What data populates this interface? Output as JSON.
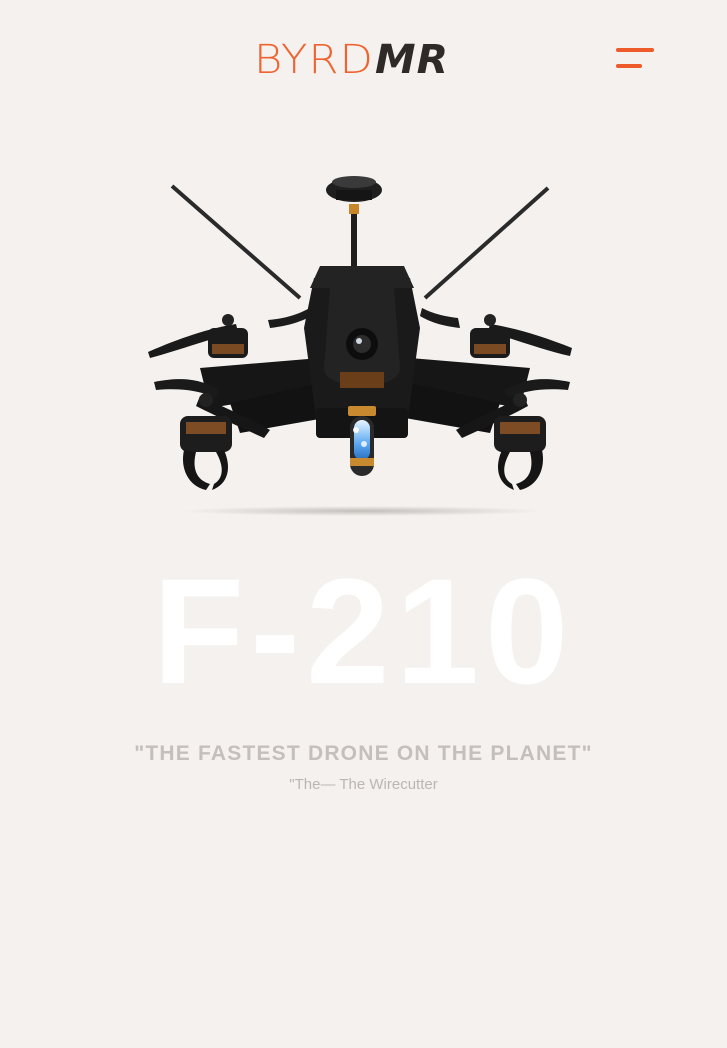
{
  "header": {
    "logo_part1": "BYRD",
    "logo_part2": "MR",
    "menu_icon": "hamburger-menu-icon"
  },
  "hero": {
    "image": "drone-product-image",
    "model_name": "F-210",
    "quote": "\"THE FASTEST DRONE ON THE PLANET\"",
    "quote_source": "\"The— The Wirecutter"
  },
  "colors": {
    "background": "#f4f1ee",
    "accent": "#ef6331",
    "logo_dark": "#2f2a27"
  }
}
